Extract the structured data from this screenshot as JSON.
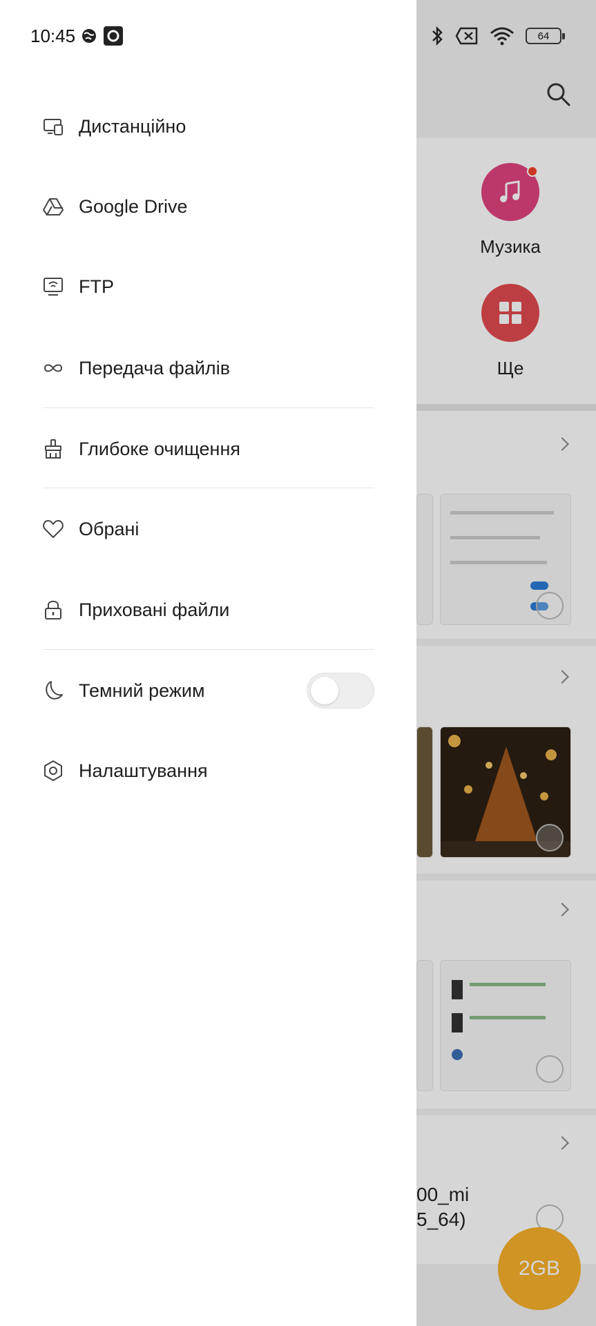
{
  "status_bar": {
    "time": "10:45",
    "battery": "64"
  },
  "background_app": {
    "music_label": "Музика",
    "more_label": "Ще",
    "file_name_line1": "00_mi",
    "file_name_line2": "5_64)",
    "storage_button": "2GB",
    "colors": {
      "music": "#e0427f",
      "more": "#e24a4f",
      "fab": "#f7b12a"
    }
  },
  "drawer": {
    "items": [
      {
        "label": "Дистанційно",
        "icon": "remote-screen-icon"
      },
      {
        "label": "Google Drive",
        "icon": "google-drive-icon"
      },
      {
        "label": "FTP",
        "icon": "ftp-icon"
      },
      {
        "label": "Передача файлів",
        "icon": "infinity-transfer-icon"
      },
      {
        "label": "Глибоке очищення",
        "icon": "broom-clean-icon"
      },
      {
        "label": "Обрані",
        "icon": "heart-icon"
      },
      {
        "label": "Приховані файли",
        "icon": "lock-icon"
      },
      {
        "label": "Темний режим",
        "icon": "moon-icon",
        "toggle": false
      },
      {
        "label": "Налаштування",
        "icon": "gear-icon"
      }
    ]
  }
}
